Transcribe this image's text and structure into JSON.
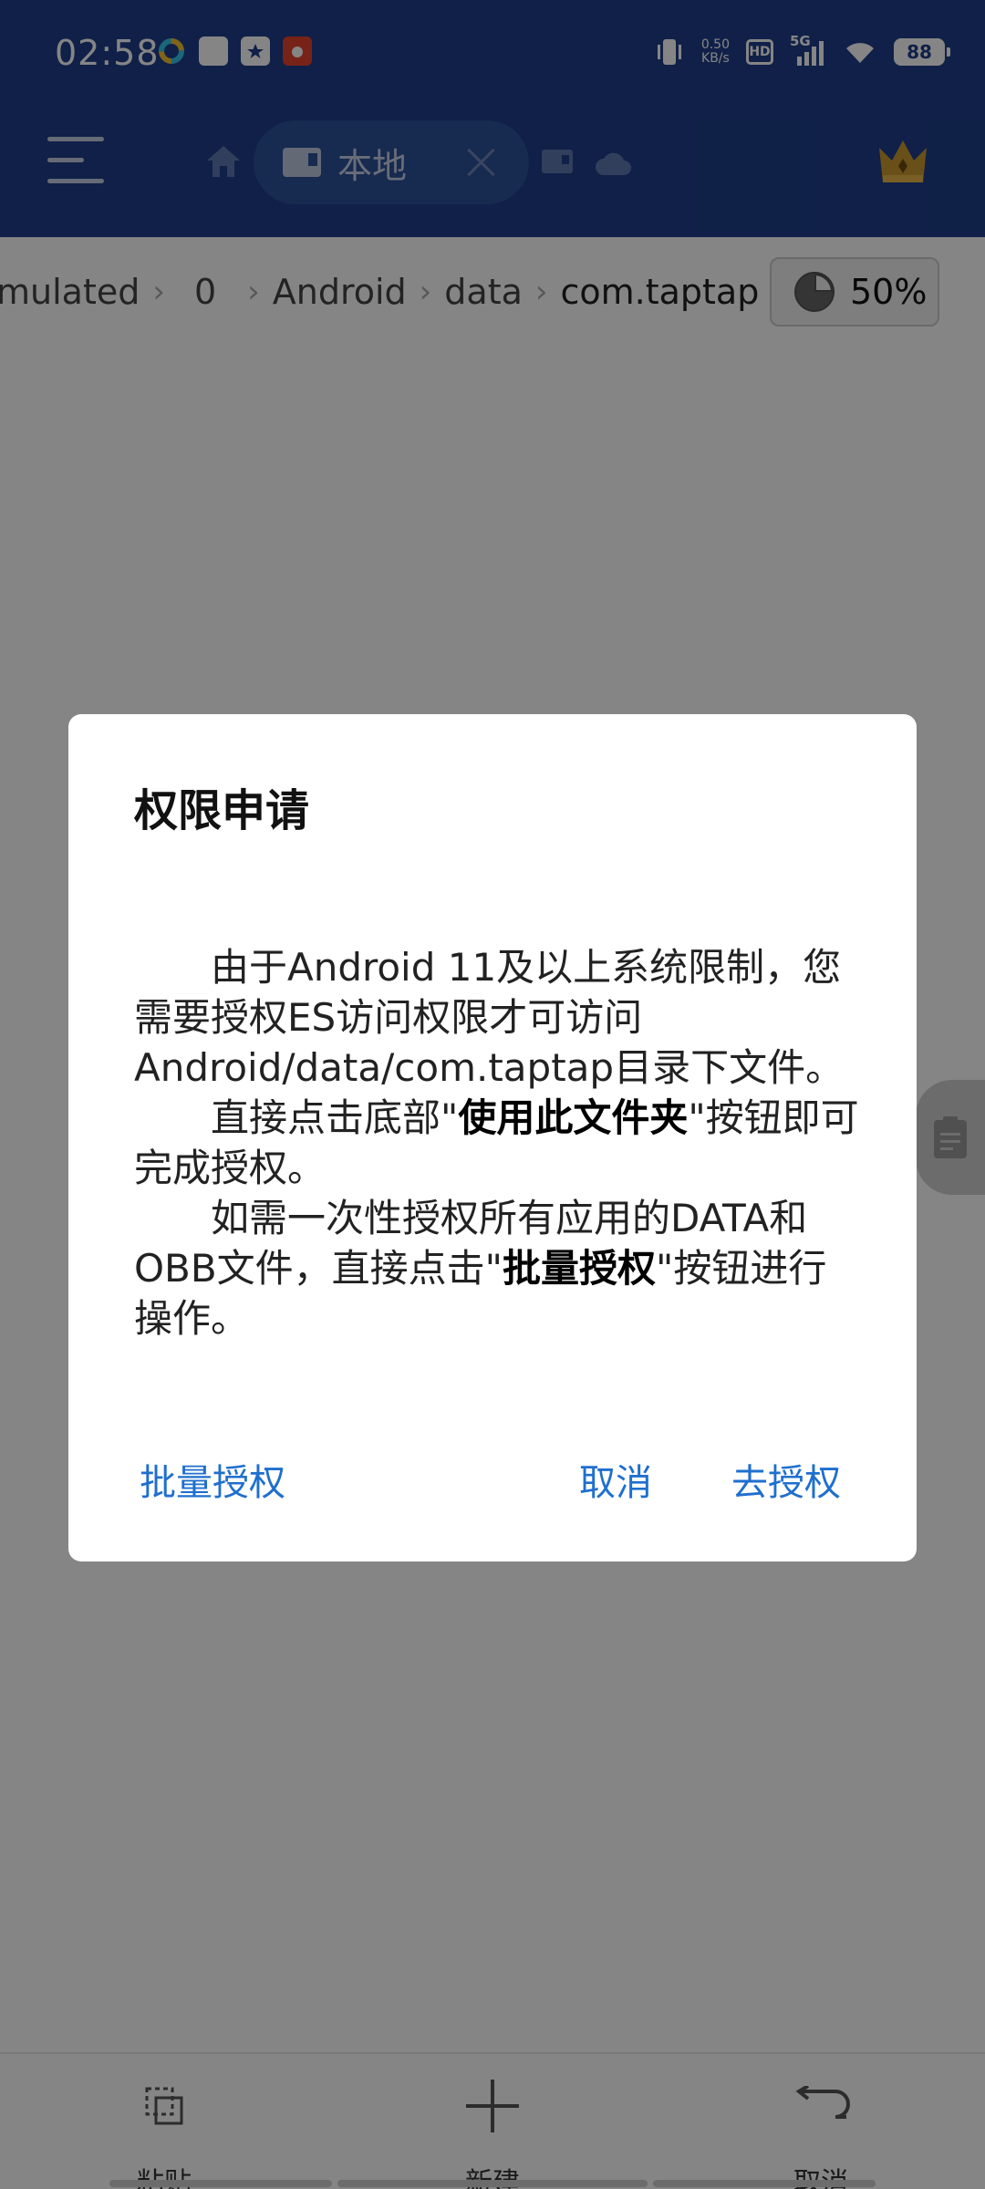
{
  "status_bar": {
    "time": "02:58",
    "net_speed_value": "0.50",
    "net_speed_unit": "KB/s",
    "hd_label": "HD",
    "network_label": "5G",
    "battery": "88"
  },
  "header": {
    "tab_label": "本地"
  },
  "breadcrumb": {
    "items": [
      "mulated",
      "0",
      "Android",
      "data",
      "com.taptap"
    ],
    "storage_usage": "50%"
  },
  "dialog": {
    "title": "权限申请",
    "para1": "由于Android 11及以上系统限制，您需要授权ES访问权限才可访问Android/data/com.taptap目录下文件。",
    "para2_prefix": "直接点击底部\"",
    "para2_bold": "使用此文件夹",
    "para2_suffix": "\"按钮即可完成授权。",
    "para3_prefix": "如需一次性授权所有应用的DATA和OBB文件，直接点击\"",
    "para3_bold": "批量授权",
    "para3_suffix": "\"按钮进行操作。",
    "btn_batch": "批量授权",
    "btn_cancel": "取消",
    "btn_authorize": "去授权"
  },
  "bottom_bar": {
    "paste": "粘贴",
    "new": "新建",
    "cancel": "取消"
  },
  "colors": {
    "header_bg": "#1f3f8a",
    "accent": "#1f6fce"
  }
}
